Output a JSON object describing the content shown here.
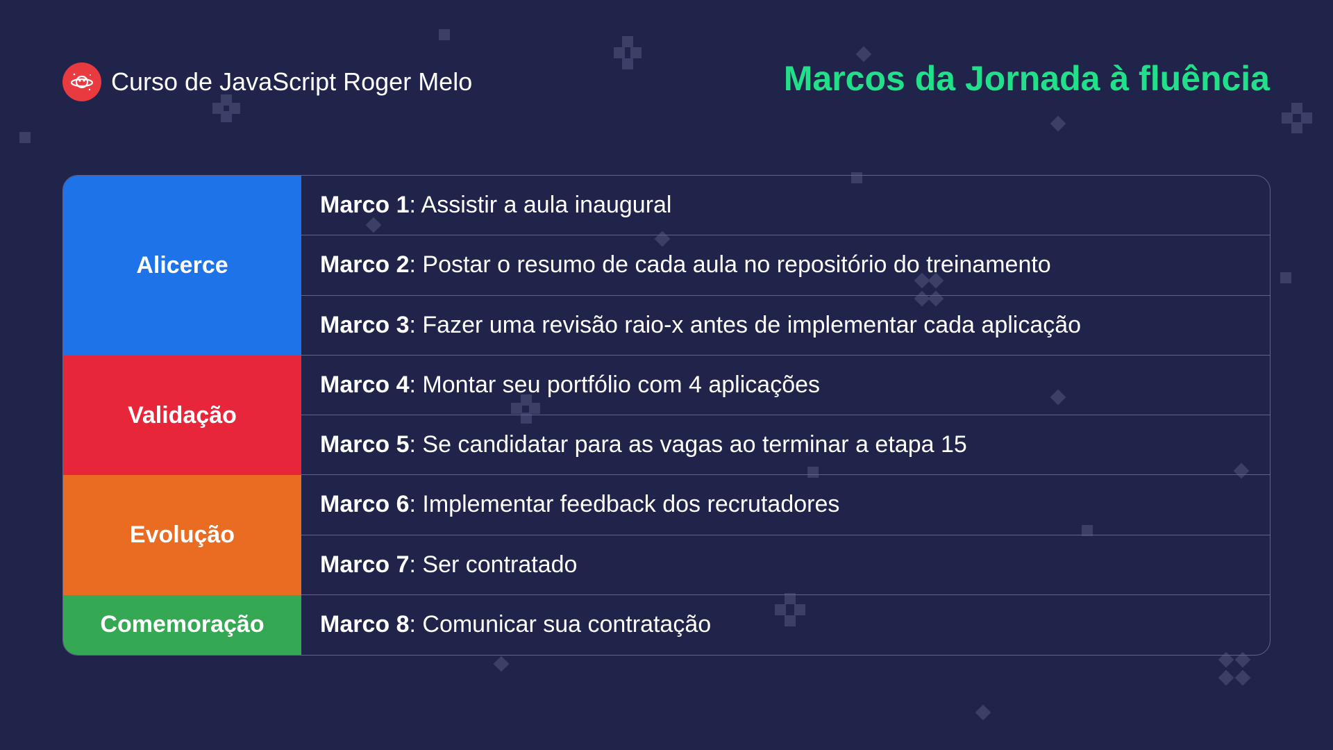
{
  "header": {
    "brand_name": "Curso de JavaScript Roger Melo",
    "logo_icon": "planet-icon",
    "title": "Marcos da Jornada à fluência"
  },
  "colors": {
    "background": "#21244a",
    "title": "#22e08a",
    "alicerce": "#1f73e8",
    "validacao": "#e8263a",
    "evolucao": "#ea6b22",
    "comemoracao": "#34a853",
    "logo": "#e93a3f"
  },
  "stages": [
    {
      "label": "Alicerce",
      "rows": 3,
      "color": "#1f73e8"
    },
    {
      "label": "Validação",
      "rows": 2,
      "color": "#e8263a"
    },
    {
      "label": "Evolução",
      "rows": 2,
      "color": "#ea6b22"
    },
    {
      "label": "Comemoração",
      "rows": 1,
      "color": "#34a853"
    }
  ],
  "milestones": [
    {
      "label": "Marco 1",
      "text": ": Assistir a aula inaugural"
    },
    {
      "label": "Marco 2",
      "text": ": Postar o resumo de cada aula no repositório do treinamento"
    },
    {
      "label": "Marco 3",
      "text": ": Fazer uma revisão raio-x antes de implementar cada aplicação"
    },
    {
      "label": "Marco 4",
      "text": ": Montar seu portfólio com 4 aplicações"
    },
    {
      "label": "Marco 5",
      "text": ": Se candidatar para as vagas ao terminar a etapa 15"
    },
    {
      "label": "Marco 6",
      "text": ": Implementar feedback dos recrutadores"
    },
    {
      "label": "Marco 7",
      "text": ": Ser contratado"
    },
    {
      "label": "Marco 8",
      "text": ": Comunicar sua contratação"
    }
  ]
}
